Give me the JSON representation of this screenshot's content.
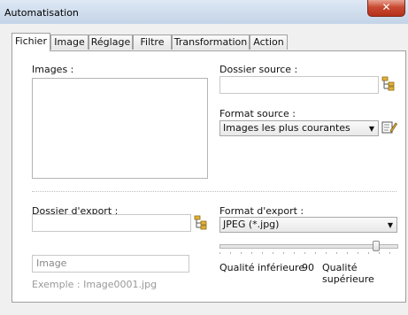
{
  "window": {
    "title": "Automatisation"
  },
  "tabs": [
    "Fichier",
    "Image",
    "Réglage",
    "Filtre",
    "Transformation",
    "Action"
  ],
  "panel": {
    "images_label": "Images :",
    "source_folder_label": "Dossier source :",
    "source_format_label": "Format source :",
    "source_format_value": "Images les plus courantes",
    "export_folder_label": "Dossier d'export :",
    "export_format_label": "Format d'export :",
    "export_format_value": "JPEG (*.jpg)",
    "name_value": "Image",
    "example": "Exemple : Image0001.jpg",
    "quality_low_label": "Qualité inférieure",
    "quality_value": "90",
    "quality_high_label": "Qualité supérieure",
    "quality_slider_fraction": 0.9
  },
  "icons": {
    "source_browse": "folder-tree-icon",
    "edit_formats": "edit-list-icon",
    "export_browse": "folder-tree-icon"
  }
}
